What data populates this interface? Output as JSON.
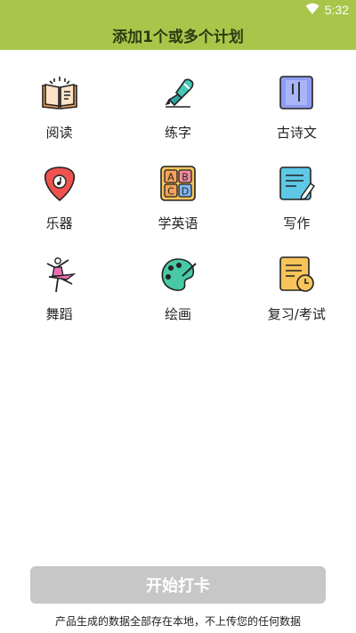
{
  "status_bar": {
    "time": "5:32",
    "icon": "wifi-icon"
  },
  "header": {
    "title": "添加1个或多个计划"
  },
  "plans": [
    {
      "label": "阅读",
      "icon": "open-book-icon"
    },
    {
      "label": "练字",
      "icon": "pen-icon"
    },
    {
      "label": "古诗文",
      "icon": "scroll-icon"
    },
    {
      "label": "乐器",
      "icon": "guitar-pick-icon"
    },
    {
      "label": "学英语",
      "icon": "abcd-blocks-icon"
    },
    {
      "label": "写作",
      "icon": "writing-note-icon"
    },
    {
      "label": "舞蹈",
      "icon": "dancer-icon"
    },
    {
      "label": "绘画",
      "icon": "palette-icon"
    },
    {
      "label": "复习/考试",
      "icon": "exam-clock-icon"
    }
  ],
  "start_button": {
    "label": "开始打卡"
  },
  "footer": {
    "note": "产品生成的数据全部存在本地，不上传您的任何数据"
  },
  "colors": {
    "header_bg": "#a9c64a",
    "button_disabled": "#c7c7c7"
  }
}
